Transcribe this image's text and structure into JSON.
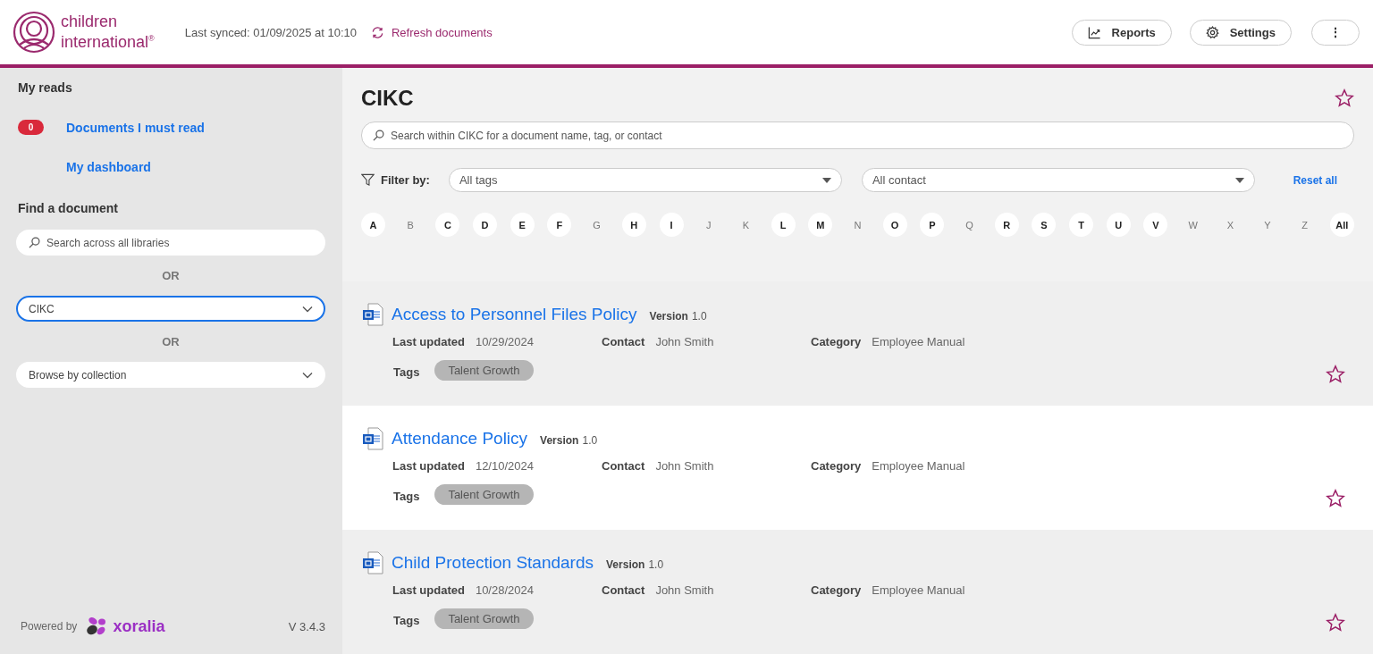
{
  "header": {
    "logo_lines": [
      "children",
      "international$^{®}$"
    ],
    "last_synced": "Last synced: 01/09/2025 at 10:10",
    "refresh": "Refresh documents",
    "buttons": [
      {
        "kind": "reports",
        "label": "Reports"
      },
      {
        "kind": "settings",
        "label": "Settings"
      },
      {
        "kind": "more",
        "label": "⋮"
      }
    ]
  },
  "sidebar": {
    "my_reads_title": "My reads",
    "links": [
      {
        "badge": "0",
        "label": "Documents I must read"
      },
      {
        "label": "My dashboard"
      }
    ],
    "find_title": "Find a document",
    "search": {
      "placeholder": "Search across all libraries"
    },
    "or_1": "OR",
    "library_select": {
      "value": "CIKC",
      "focused": true
    },
    "or_2": "OR",
    "collection_select": {
      "value": "Browse by collection",
      "focused": false
    },
    "powered_by": "Powered by",
    "brand": "xoralia",
    "version": "V 3.4.3"
  },
  "main": {
    "title": "CIKC",
    "starred": false,
    "search": {
      "placeholder": "Search within CIKC for a document name, tag, or contact"
    },
    "filter_label": "Filter by:",
    "tags_select": "All tags",
    "contact_select": "All contact",
    "reset": "Reset all",
    "letters": [
      {
        "label": "A",
        "available": true
      },
      {
        "label": "B",
        "available": false
      },
      {
        "label": "C",
        "available": true
      },
      {
        "label": "D",
        "available": true
      },
      {
        "label": "E",
        "available": true
      },
      {
        "label": "F",
        "available": true
      },
      {
        "label": "G",
        "available": false
      },
      {
        "label": "H",
        "available": true
      },
      {
        "label": "I",
        "available": true
      },
      {
        "label": "J",
        "available": false
      },
      {
        "label": "K",
        "available": false
      },
      {
        "label": "L",
        "available": true
      },
      {
        "label": "M",
        "available": true
      },
      {
        "label": "N",
        "available": false
      },
      {
        "label": "O",
        "available": true
      },
      {
        "label": "P",
        "available": true
      },
      {
        "label": "Q",
        "available": false
      },
      {
        "label": "R",
        "available": true
      },
      {
        "label": "S",
        "available": true
      },
      {
        "label": "T",
        "available": true
      },
      {
        "label": "U",
        "available": true
      },
      {
        "label": "V",
        "available": true
      },
      {
        "label": "W",
        "available": false
      },
      {
        "label": "X",
        "available": false
      },
      {
        "label": "Y",
        "available": false
      },
      {
        "label": "Z",
        "available": false
      },
      {
        "label": "All",
        "available": true
      }
    ],
    "documents": [
      {
        "title": "Access to Personnel Files Policy",
        "version_label": "Version",
        "version": "1.0",
        "updated_label": "Last updated",
        "updated": "10/29/2024",
        "contact_label": "Contact",
        "contact": "John Smith",
        "category_label": "Category",
        "category": "Employee Manual",
        "tags_label": "Tags",
        "tags": [
          "Talent Growth"
        ],
        "starred": false
      },
      {
        "title": "Attendance Policy",
        "version_label": "Version",
        "version": "1.0",
        "updated_label": "Last updated",
        "updated": "12/10/2024",
        "contact_label": "Contact",
        "contact": "John Smith",
        "category_label": "Category",
        "category": "Employee Manual",
        "tags_label": "Tags",
        "tags": [
          "Talent Growth"
        ],
        "starred": false
      },
      {
        "title": "Child Protection Standards",
        "version_label": "Version",
        "version": "1.0",
        "updated_label": "Last updated",
        "updated": "10/28/2024",
        "contact_label": "Contact",
        "contact": "John Smith",
        "category_label": "Category",
        "category": "Employee Manual",
        "tags_label": "Tags",
        "tags": [
          "Talent Growth"
        ],
        "starred": false
      }
    ]
  }
}
